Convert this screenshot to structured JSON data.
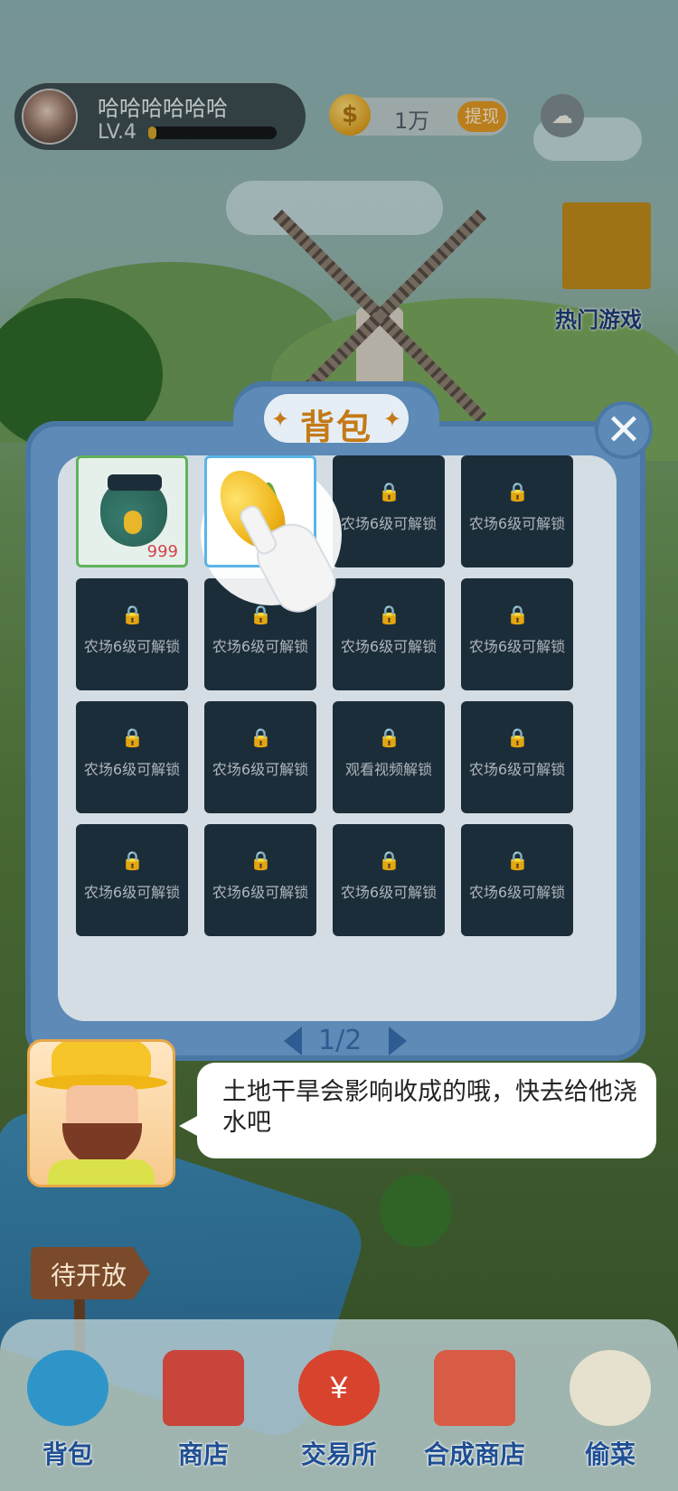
{
  "header": {
    "username": "哈哈哈哈哈哈",
    "level": "LV.4",
    "xp_fraction": 0.06,
    "coins": "1万",
    "withdraw_label": "提现"
  },
  "hot_games": {
    "label": "热门游戏"
  },
  "bag": {
    "title": "背包",
    "close_symbol": "✕",
    "slots": [
      {
        "type": "item",
        "item": "seed-bag",
        "count": "999"
      },
      {
        "type": "item",
        "item": "corn"
      },
      {
        "type": "locked",
        "label": "农场6级可解锁"
      },
      {
        "type": "locked",
        "label": "农场6级可解锁"
      },
      {
        "type": "locked",
        "label": "农场6级可解锁"
      },
      {
        "type": "locked",
        "label": "农场6级可解锁"
      },
      {
        "type": "locked",
        "label": "农场6级可解锁"
      },
      {
        "type": "locked",
        "label": "农场6级可解锁"
      },
      {
        "type": "locked",
        "label": "农场6级可解锁"
      },
      {
        "type": "locked",
        "label": "农场6级可解锁"
      },
      {
        "type": "video",
        "label": "观看视频解锁"
      },
      {
        "type": "locked",
        "label": "农场6级可解锁"
      },
      {
        "type": "locked",
        "label": "农场6级可解锁"
      },
      {
        "type": "locked",
        "label": "农场6级可解锁"
      },
      {
        "type": "locked",
        "label": "农场6级可解锁"
      },
      {
        "type": "locked",
        "label": "农场6级可解锁"
      }
    ],
    "page": "1/2"
  },
  "tip": {
    "text": "土地干旱会影响收成的哦，快去给他浇水吧"
  },
  "signpost": {
    "label": "待开放"
  },
  "nav": [
    {
      "label": "背包",
      "icon": "backpack-icon",
      "color": "#2f95c8"
    },
    {
      "label": "商店",
      "icon": "shop-icon",
      "color": "#c9443a"
    },
    {
      "label": "交易所",
      "icon": "money-bag-icon",
      "color": "#d8432e"
    },
    {
      "label": "合成商店",
      "icon": "house-icon",
      "color": "#d85b45"
    },
    {
      "label": "偷菜",
      "icon": "steal-hand-icon",
      "color": "#e6e0cf"
    }
  ],
  "colors": {
    "panel": "#5d8ab6",
    "accent_gold": "#c47a17",
    "nav_label": "#1f4f93",
    "locked_slot": "#1c2d3a"
  }
}
